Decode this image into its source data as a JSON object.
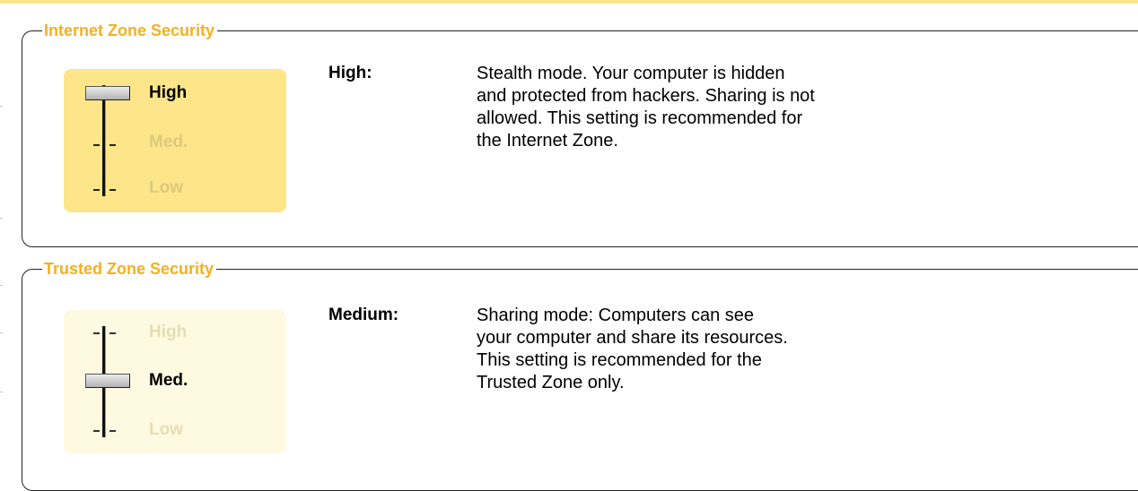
{
  "colors": {
    "group_title": "#f5b01e",
    "active_panel": "#fde689",
    "inactive_panel": "#fef9e1",
    "top_rule": "#fde38a"
  },
  "internet_zone": {
    "title": "Internet Zone Security",
    "slider": {
      "levels": [
        "High",
        "Med.",
        "Low"
      ],
      "selected": "High"
    },
    "description_label": "High:",
    "description_text": "Stealth mode.  Your computer is hidden\nand protected from hackers.  Sharing is not\nallowed.  This setting is recommended for\nthe Internet Zone."
  },
  "trusted_zone": {
    "title": "Trusted Zone Security",
    "slider": {
      "levels": [
        "High",
        "Med.",
        "Low"
      ],
      "selected": "Med."
    },
    "description_label": "Medium:",
    "description_text": "Sharing mode:  Computers can see\nyour computer and share its resources.\n This setting is recommended for the\nTrusted Zone only."
  }
}
